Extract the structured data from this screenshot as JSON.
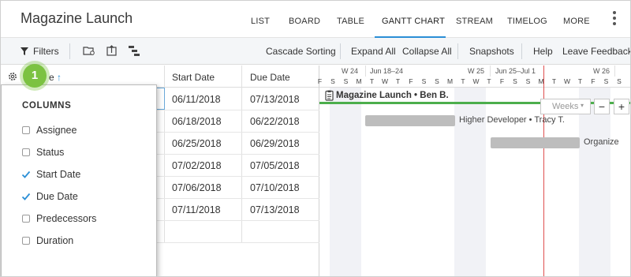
{
  "app": {
    "title": "Magazine Launch"
  },
  "nav": {
    "tabs": [
      "LIST",
      "BOARD",
      "TABLE",
      "GANTT CHART",
      "STREAM",
      "TIMELOG",
      "MORE"
    ],
    "active": "GANTT CHART"
  },
  "toolbar": {
    "filters": "Filters",
    "cascade_sorting": "Cascade Sorting",
    "expand_all": "Expand All",
    "collapse_all": "Collapse All",
    "snapshots": "Snapshots",
    "help": "Help",
    "leave_feedback": "Leave Feedback"
  },
  "grid": {
    "name_col_partial": "e",
    "columns": [
      "Start Date",
      "Due Date"
    ],
    "rows": [
      {
        "start": "06/11/2018",
        "due": "07/13/2018"
      },
      {
        "start": "06/18/2018",
        "due": "06/22/2018"
      },
      {
        "start": "06/25/2018",
        "due": "06/29/2018"
      },
      {
        "start": "07/02/2018",
        "due": "07/05/2018"
      },
      {
        "start": "07/06/2018",
        "due": "07/10/2018"
      },
      {
        "start": "07/11/2018",
        "due": "07/13/2018"
      }
    ]
  },
  "gantt": {
    "weeks": [
      "W 24",
      "Jun 18–24",
      "W 25",
      "Jun 25–Jul 1",
      "W 26"
    ],
    "days": [
      "F",
      "S",
      "S",
      "M",
      "T",
      "W",
      "T",
      "F",
      "S",
      "S",
      "M",
      "T",
      "W",
      "T",
      "F",
      "S",
      "S",
      "M",
      "T",
      "W",
      "T",
      "F",
      "S",
      "S"
    ],
    "project_label": "Magazine Launch • Ben B.",
    "task_label_1": "Higher Developer • Tracy T.",
    "task_label_2": "Organize",
    "zoom_value": "Weeks",
    "zoom_minus": "−",
    "zoom_plus": "+"
  },
  "columns_panel": {
    "title": "COLUMNS",
    "badge": "1",
    "options": [
      {
        "label": "Assignee",
        "checked": false
      },
      {
        "label": "Status",
        "checked": false
      },
      {
        "label": "Start Date",
        "checked": true
      },
      {
        "label": "Due Date",
        "checked": true
      },
      {
        "label": "Predecessors",
        "checked": false
      },
      {
        "label": "Duration",
        "checked": false
      }
    ]
  },
  "colors": {
    "accent": "#2b8fd6",
    "badge": "#7cc242",
    "today": "#e05050",
    "project_line": "#4cae4c"
  }
}
